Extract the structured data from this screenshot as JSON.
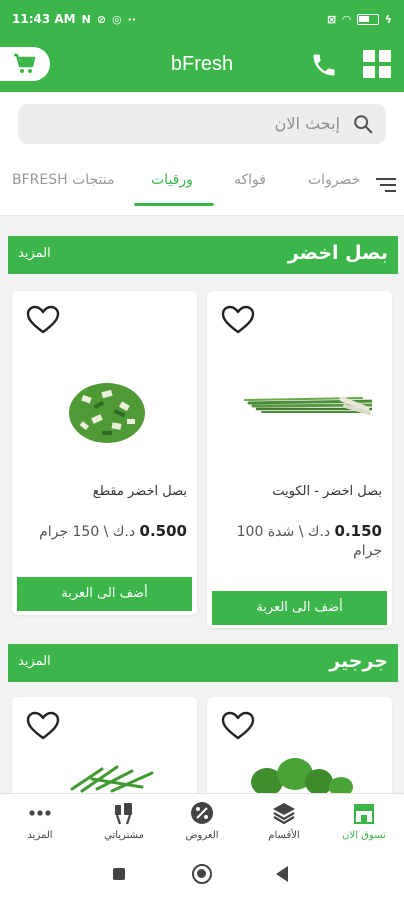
{
  "status_bar": {
    "time": "11:43 AM",
    "icons": [
      "notification-n-icon",
      "dnd-icon",
      "data-saver-icon",
      "more-dots-icon",
      "sim-icon",
      "wifi-icon",
      "battery-icon",
      "charging-icon"
    ],
    "more": "··"
  },
  "app_bar": {
    "title": "bFresh",
    "icons": [
      "cart-icon",
      "phone-icon",
      "grid-icon"
    ]
  },
  "search": {
    "placeholder": "إبحث الان"
  },
  "tabs": [
    {
      "label": "خضروات"
    },
    {
      "label": "فواكه"
    },
    {
      "label": "ورقيات",
      "active": true
    },
    {
      "label": "منتجات BFRESH"
    }
  ],
  "sections": [
    {
      "title": "بصل اخضر",
      "more": "المزيد",
      "products": [
        {
          "name": "بصل اخضر - الكويت",
          "price": "0.150",
          "currency": "د.ك",
          "unit": "\\ شدة 100 جرام",
          "add_label": "أضف الى العربة"
        },
        {
          "name": "بصل اخضر مقطع",
          "price": "0.500",
          "currency": "د.ك",
          "unit": "\\ 150 جرام",
          "add_label": "أضف الى العربة"
        }
      ]
    },
    {
      "title": "جرجير",
      "more": "المزيد",
      "products": [
        {
          "name": ""
        },
        {
          "name": ""
        }
      ]
    }
  ],
  "bottom_nav": [
    {
      "label": "تسوق الان",
      "icon": "store-icon",
      "active": true
    },
    {
      "label": "الأقسام",
      "icon": "layers-icon"
    },
    {
      "label": "العروض",
      "icon": "discount-icon"
    },
    {
      "label": "مشترياتي",
      "icon": "purchases-icon"
    },
    {
      "label": "المزيد",
      "icon": "more-dots-icon"
    }
  ],
  "colors": {
    "brand_green": "#3cb64a",
    "background": "#f2f2f2",
    "text_gray": "#9a9a9a"
  }
}
